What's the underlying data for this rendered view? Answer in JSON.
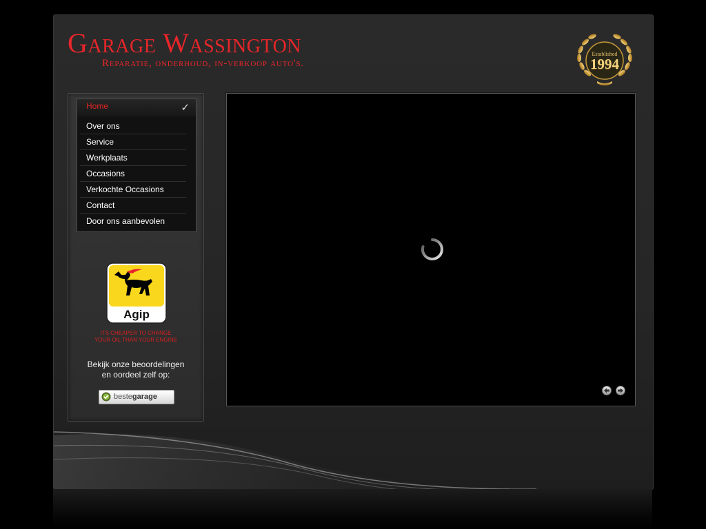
{
  "header": {
    "title": "Garage Wassington",
    "subtitle": "Reparatie, onderhoud, in-verkoop auto's.",
    "badge": {
      "label": "Established",
      "year": "1994"
    }
  },
  "menu": {
    "items": [
      {
        "label": "Home",
        "active": true
      },
      {
        "label": "Over ons"
      },
      {
        "label": "Service"
      },
      {
        "label": "Werkplaats"
      },
      {
        "label": "Occasions"
      },
      {
        "label": "Verkochte Occasions"
      },
      {
        "label": "Contact"
      },
      {
        "label": "Door ons aanbevolen"
      }
    ],
    "active_check": "✓"
  },
  "sponsor": {
    "logo_text": "Agip",
    "slogan_line1": "ITS CHEAPER TO CHANGE",
    "slogan_line2": "YOUR OIL THAN YOUR ENGINE"
  },
  "reviews": {
    "line1": "Bekijk onze beoordelingen",
    "line2": "en oordeel zelf op:",
    "button_prefix": "beste",
    "button_suffix": "garage"
  },
  "colors": {
    "accent": "#e8262a",
    "gold": "#e7c26a",
    "background": "#000000"
  }
}
